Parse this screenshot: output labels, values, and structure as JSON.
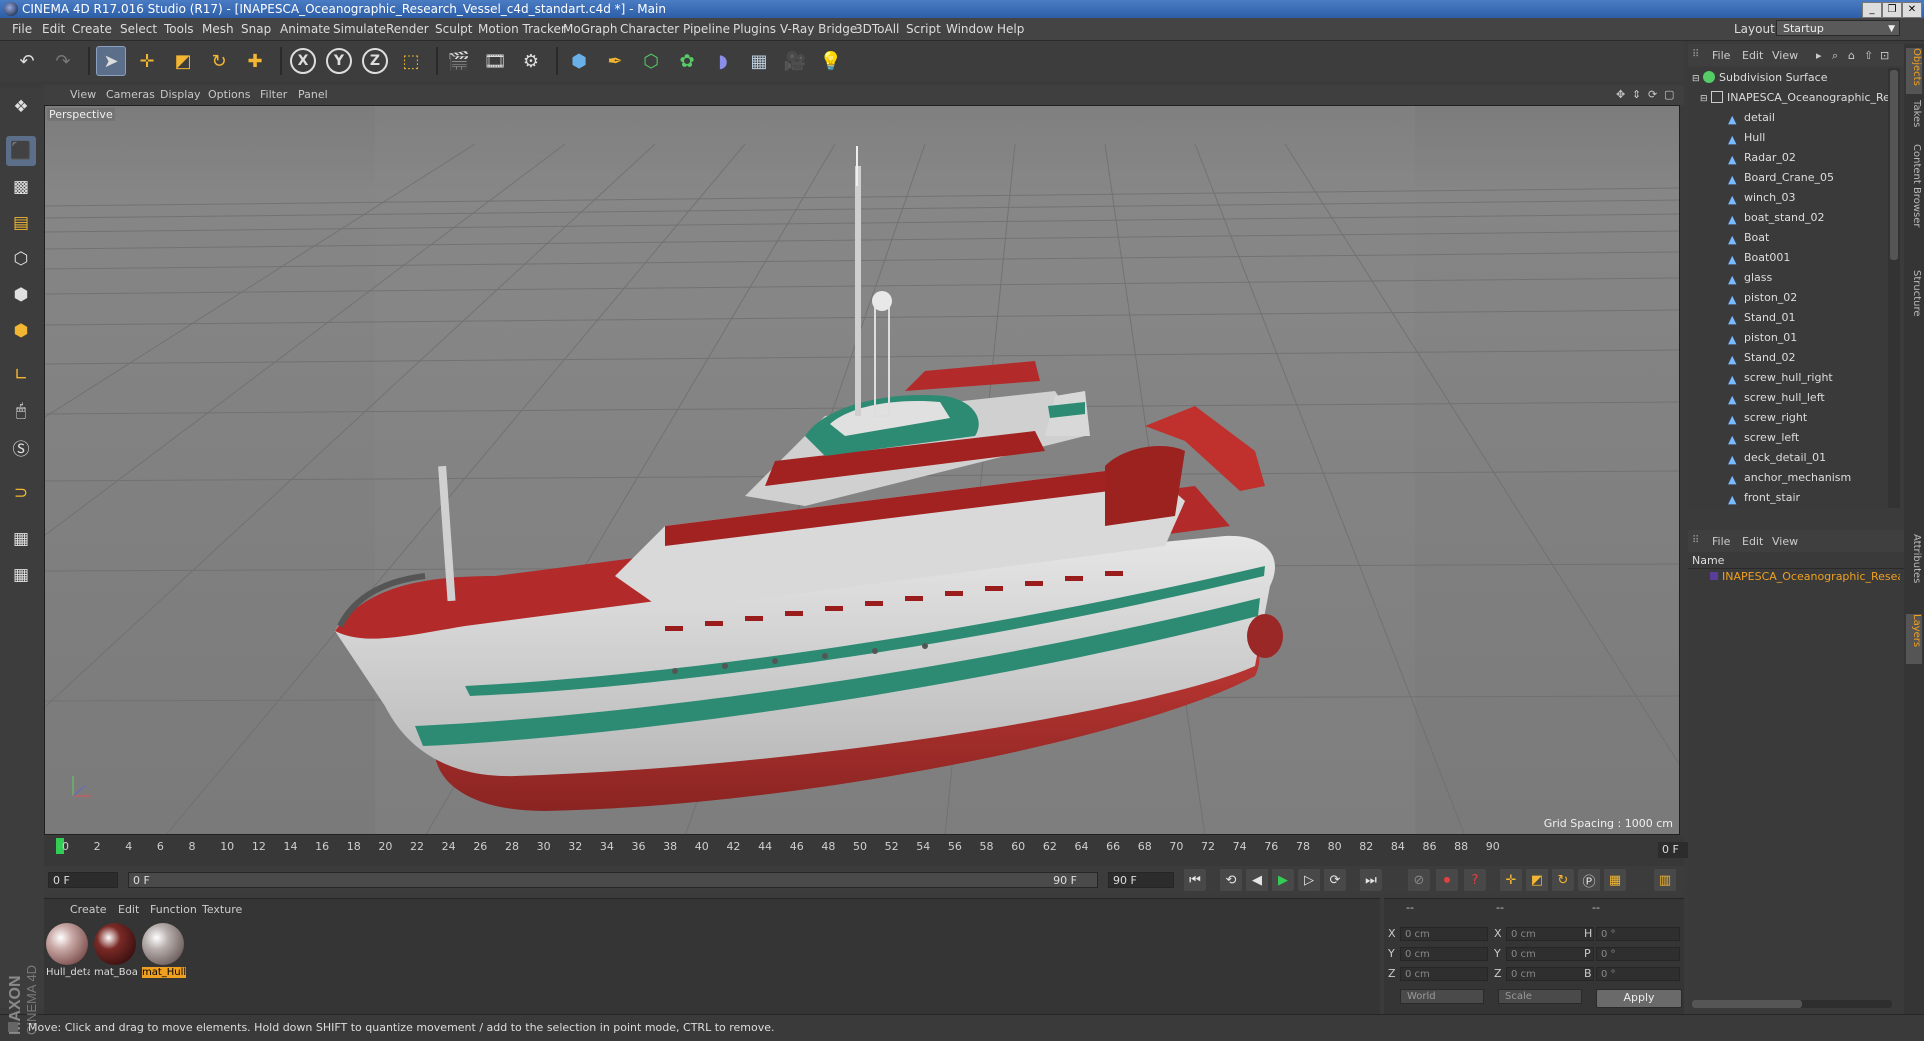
{
  "window": {
    "title": "CINEMA 4D R17.016 Studio (R17) - [INAPESCA_Oceanographic_Research_Vessel_c4d_standart.c4d *] - Main",
    "buttons": [
      "_",
      "❐",
      "✕"
    ]
  },
  "menubar": {
    "items": [
      "File",
      "Edit",
      "Create",
      "Select",
      "Tools",
      "Mesh",
      "Snap",
      "Animate",
      "Simulate",
      "Render",
      "Sculpt",
      "Motion Tracker",
      "MoGraph",
      "Character",
      "Pipeline",
      "Plugins",
      "V-Ray Bridge",
      "3DToAll",
      "Script",
      "Window",
      "Help"
    ],
    "layout_label": "Layout:",
    "layout_value": "Startup"
  },
  "toolbar": {
    "groups": [
      [
        "undo-icon",
        "redo-icon"
      ],
      [
        "select-arrow-icon",
        "move-icon",
        "scale-icon",
        "rotate-icon",
        "live-select-icon"
      ],
      [
        "x-axis-icon",
        "y-axis-icon",
        "z-axis-icon",
        "coordinate-system-icon"
      ],
      [
        "render-view-icon",
        "render-picture-viewer-icon",
        "render-settings-icon"
      ],
      [
        "cube-icon",
        "pen-spline-icon",
        "subdivision-icon",
        "cloner-icon",
        "deformer-icon",
        "floor-icon",
        "camera-icon",
        "light-icon"
      ]
    ],
    "axis_labels": [
      "X",
      "Y",
      "Z"
    ]
  },
  "left_tools": [
    "make-editable-icon",
    "model-mode-icon",
    "texture-mode-icon",
    "workplane-icon",
    "points-mode-icon",
    "edges-mode-icon",
    "polygons-mode-icon",
    "axis-mode-icon",
    "tweak-mode-icon",
    "snap-icon",
    "magnet-icon",
    "enable-axis-icon",
    "lock-workplane-icon"
  ],
  "viewport": {
    "menu": [
      "View",
      "Cameras",
      "Display",
      "Options",
      "Filter",
      "Panel"
    ],
    "label": "Perspective",
    "grid_spacing": "Grid Spacing : 1000 cm"
  },
  "timeline": {
    "ticks": [
      "0",
      "2",
      "4",
      "6",
      "8",
      "10",
      "12",
      "14",
      "16",
      "18",
      "20",
      "22",
      "24",
      "26",
      "28",
      "30",
      "32",
      "34",
      "36",
      "38",
      "40",
      "42",
      "44",
      "46",
      "48",
      "50",
      "52",
      "54",
      "56",
      "58",
      "60",
      "62",
      "64",
      "66",
      "68",
      "70",
      "72",
      "74",
      "76",
      "78",
      "80",
      "82",
      "84",
      "86",
      "88",
      "90"
    ],
    "current_frame": "0 F",
    "start_field": "0 F",
    "range_start": "0 F",
    "range_end": "90 F",
    "end_field": "90 F"
  },
  "material_panel": {
    "menu": [
      "Create",
      "Edit",
      "Function",
      "Texture"
    ],
    "materials": [
      {
        "name": "Hull_deta",
        "selected": false,
        "color": "#c9a9a6"
      },
      {
        "name": "mat_Boa",
        "selected": false,
        "color": "#7a2a26"
      },
      {
        "name": "mat_Hull",
        "selected": true,
        "color": "#b8b0ae"
      }
    ]
  },
  "coordinates": {
    "headers": [
      "--",
      "--",
      "--"
    ],
    "rows": [
      {
        "a": "X",
        "av": "0 cm",
        "b": "X",
        "bv": "0 cm",
        "c": "H",
        "cv": "0 °"
      },
      {
        "a": "Y",
        "av": "0 cm",
        "b": "Y",
        "bv": "0 cm",
        "c": "P",
        "cv": "0 °"
      },
      {
        "a": "Z",
        "av": "0 cm",
        "b": "Z",
        "bv": "0 cm",
        "c": "B",
        "cv": "0 °"
      }
    ],
    "mode": "World",
    "scale": "Scale",
    "apply": "Apply"
  },
  "status": "Move: Click and drag to move elements. Hold down SHIFT to quantize movement / add to the selection in point mode, CTRL to remove.",
  "brand": {
    "line1": "MAXON",
    "line2": "CINEMA 4D"
  },
  "object_manager": {
    "menu": [
      "File",
      "Edit",
      "View"
    ],
    "root": "Subdivision Surface",
    "model": "INAPESCA_Oceanographic_Resea",
    "children": [
      "detail",
      "Hull",
      "Radar_02",
      "Board_Crane_05",
      "winch_03",
      "boat_stand_02",
      "Boat",
      "Boat001",
      "glass",
      "piston_02",
      "Stand_01",
      "piston_01",
      "Stand_02",
      "screw_hull_right",
      "screw_hull_left",
      "screw_right",
      "screw_left",
      "deck_detail_01",
      "anchor_mechanism",
      "front_stair"
    ]
  },
  "layer_manager": {
    "menu": [
      "File",
      "Edit",
      "View"
    ],
    "name_header": "Name",
    "row": "INAPESCA_Oceanographic_Researc"
  },
  "side_tabs": [
    "Objects",
    "Takes",
    "Content Browser",
    "Structure",
    "Attributes",
    "Layers"
  ],
  "colors": {
    "accent": "#f0a020",
    "selection": "#5b6f8a",
    "hull_red": "#b32a2a",
    "stripe_green": "#2e8b73"
  }
}
